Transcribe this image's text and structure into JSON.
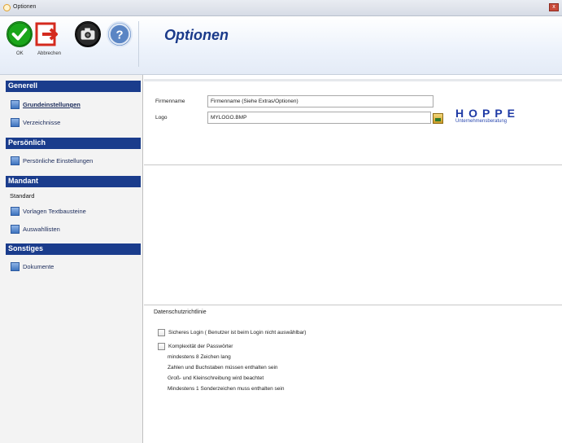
{
  "window": {
    "title": "Optionen",
    "close_glyph": "x"
  },
  "toolbar": {
    "ok_label": "OK",
    "cancel_label": "Abbrechen",
    "camera_icon": "camera-icon",
    "help_icon": "help-icon",
    "page_title": "Optionen"
  },
  "sidebar": {
    "groups": [
      {
        "title": "Generell",
        "items": [
          "Grundeinstellungen",
          "Verzeichnisse"
        ]
      },
      {
        "title": "Persönlich",
        "items": [
          "Persönliche Einstellungen"
        ]
      },
      {
        "title": "Mandant",
        "plain": "Standard",
        "items": [
          "Vorlagen Textbausteine",
          "Auswahllisten"
        ]
      },
      {
        "title": "Sonstiges",
        "items": [
          "Dokumente"
        ]
      }
    ]
  },
  "form": {
    "company_label": "Firmenname",
    "company_value": "Firmenname (Siehe Extras/Optionen)",
    "logo_label": "Logo",
    "logo_value": "MYLOGO.BMP"
  },
  "logo": {
    "word": "HOPPE",
    "subtitle": "Unternehmensberatung"
  },
  "privacy": {
    "title": "Datenschutzrichtlinie",
    "secure_login": "Sicheres Login ( Benutzer ist beim Login nicht auswählbar)",
    "complexity": "Komplexität der Passwörter",
    "rules": [
      "mindestens 8 Zeichen lang",
      "Zahlen und Buchstaben müssen enthalten sein",
      "Groß- und Kleinschreibung wird beachtet",
      "Mindestens 1 Sonderzeichen muss enthalten sein"
    ]
  },
  "colors": {
    "accent_blue": "#1a3c8c",
    "title_blue": "#1a3a8a",
    "ok_green": "#19a21a",
    "cancel_red": "#d42a1e"
  }
}
